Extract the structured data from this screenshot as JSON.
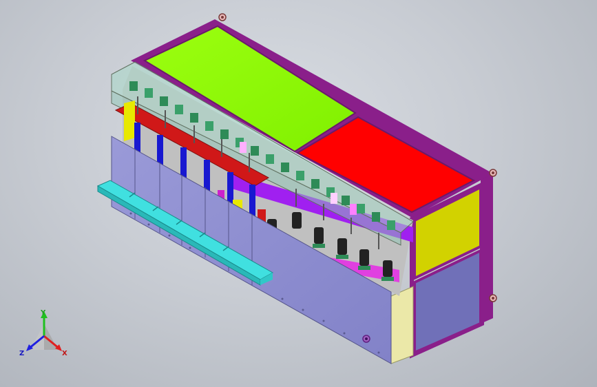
{
  "viewport": {
    "model": "cad-assembly-isometric",
    "background_style": "gradient-gray"
  },
  "colors": {
    "frame": "#8a1f8a",
    "lime_panel": "#8cff00",
    "red_panel": "#ff0000",
    "yellow_panel": "#d4d400",
    "lavender_panel": "#8f8fd0",
    "side_panel": "#6e6eb8",
    "cream_post": "#ebe8a8",
    "cyan_tray": "#40e0e0",
    "green_parts": "#2e8b57",
    "blue_part": "#1818d0",
    "magenta_part": "#cc22cc",
    "dark_part": "#222222"
  },
  "triad": {
    "axis_x": "X",
    "axis_y": "Y",
    "axis_z": "Z",
    "x_color": "#e02020",
    "y_color": "#20c020",
    "z_color": "#2020e0"
  }
}
